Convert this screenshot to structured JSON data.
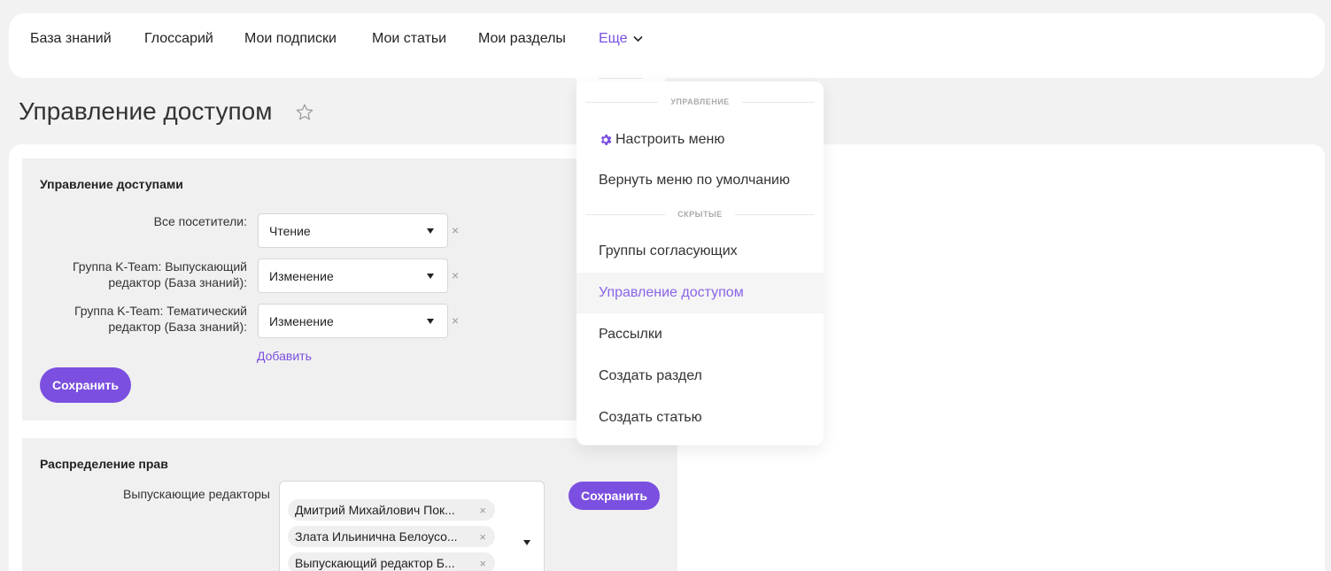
{
  "nav": {
    "items": [
      "База знаний",
      "Глоссарий",
      "Мои подписки",
      "Мои статьи",
      "Мои разделы"
    ],
    "more_label": "Еще"
  },
  "page": {
    "title": "Управление доступом"
  },
  "access_panel": {
    "title": "Управление доступами",
    "rows": [
      {
        "label_lines": [
          "Все посетители:"
        ],
        "value": "Чтение"
      },
      {
        "label_lines": [
          "Группа K-Team: Выпускающий",
          "редактор (База знаний):"
        ],
        "value": "Изменение"
      },
      {
        "label_lines": [
          "Группа K-Team: Тематический",
          "редактор (База знаний):"
        ],
        "value": "Изменение"
      }
    ],
    "remove_glyph": "×",
    "add_label": "Добавить",
    "save_label": "Сохранить"
  },
  "rights_panel": {
    "title": "Распределение прав",
    "field_label": "Выпускающие редакторы",
    "chips": [
      "Дмитрий Михайлович Пок...",
      "Злата Ильинична Белоусо...",
      "Выпускающий редактор Б..."
    ],
    "chip_remove_glyph": "×",
    "save_label": "Сохранить"
  },
  "dropdown": {
    "section_manage": "УПРАВЛЕНИЕ",
    "configure_label": "Настроить меню",
    "reset_label": "Вернуть меню по умолчанию",
    "section_hidden": "СКРЫТЫЕ",
    "hidden_items": [
      "Группы согласующих",
      "Управление доступом",
      "Рассылки",
      "Создать раздел",
      "Создать статью"
    ],
    "active_item": "Управление доступом"
  },
  "colors": {
    "accent": "#7b4fe0",
    "page_bg": "#f2f2f2",
    "panel_bg": "#f0f0f0",
    "muted": "#999999"
  },
  "icons": [
    "chevron-down-icon",
    "star-icon",
    "gear-icon",
    "caret-down-icon",
    "close-icon"
  ]
}
